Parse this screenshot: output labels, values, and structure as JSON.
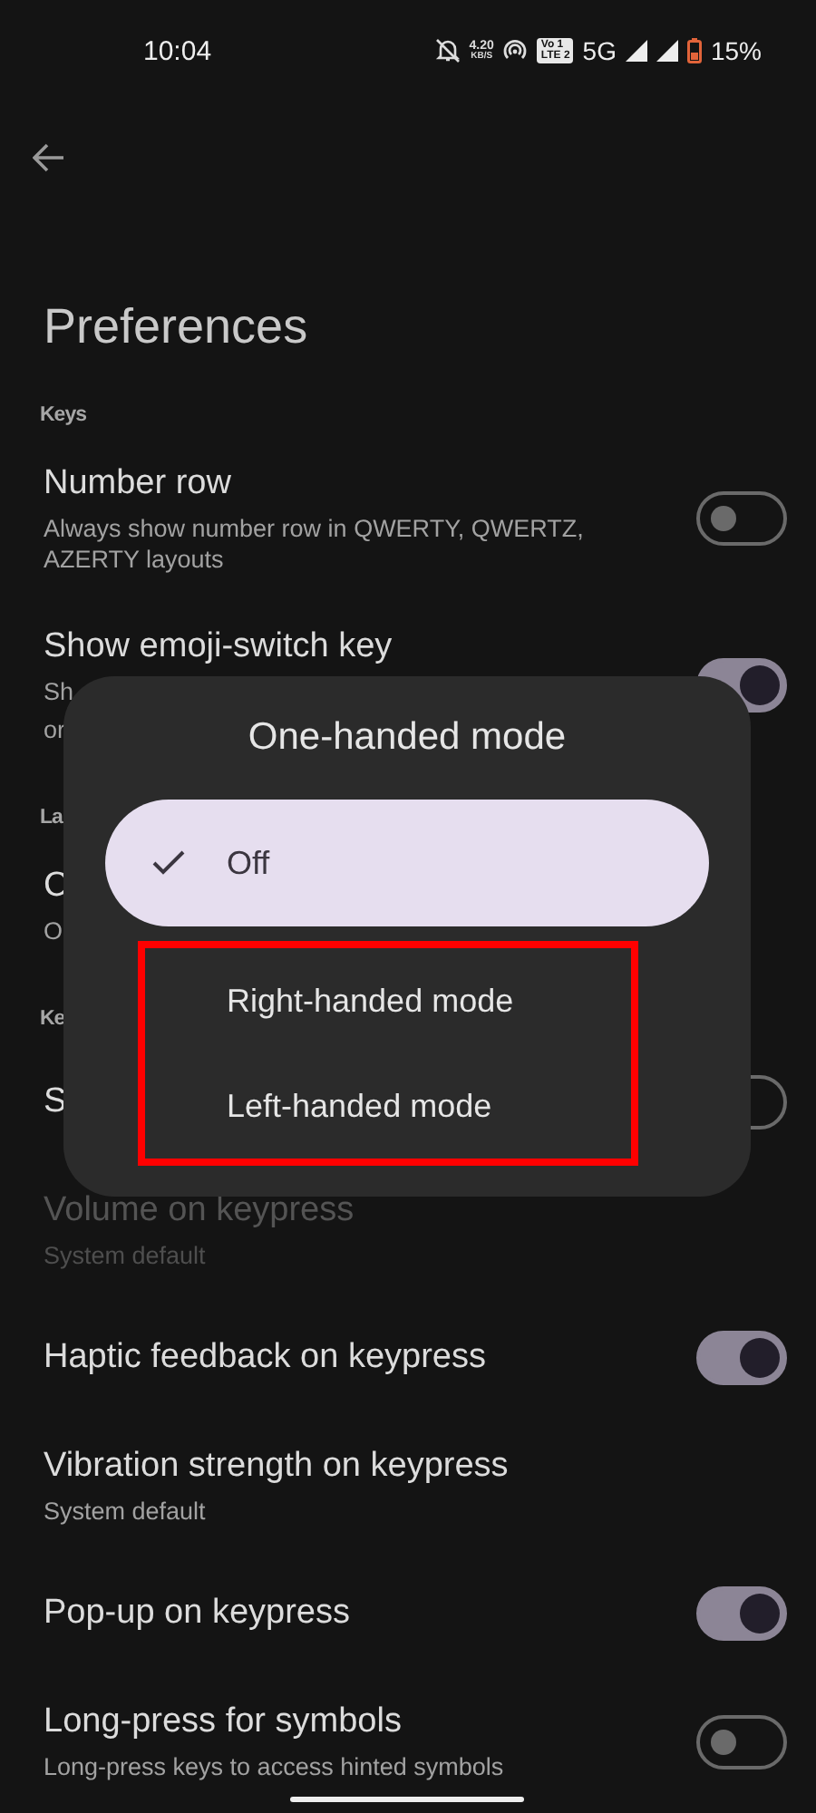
{
  "status_bar": {
    "time": "10:04",
    "speed_value": "4.20",
    "speed_unit": "KB/S",
    "volte_top": "Vo 1",
    "volte_bottom": "LTE 2",
    "network": "5G",
    "battery": "15%"
  },
  "title": "Preferences",
  "items": [
    {
      "kind": "header",
      "label": "Keys"
    },
    {
      "kind": "setting",
      "title": "Number row",
      "subtitle": "Always show number row in QWERTY, QWERTZ, AZERTY layouts",
      "on": false,
      "disabled": false
    },
    {
      "kind": "setting",
      "title": "Show emoji-switch key",
      "subtitle_lines": [
        "Sh",
        "or"
      ],
      "on": true,
      "disabled": false
    },
    {
      "kind": "header",
      "label": "La"
    },
    {
      "kind": "setting",
      "title": "C",
      "subtitle": "O",
      "disabled": false
    },
    {
      "kind": "header",
      "label": "Ke"
    },
    {
      "kind": "setting",
      "title": "S",
      "on": false,
      "disabled": false
    },
    {
      "kind": "setting",
      "title": "Volume on keypress",
      "subtitle": "System default",
      "disabled": true
    },
    {
      "kind": "setting",
      "title": "Haptic feedback on keypress",
      "on": true,
      "disabled": false
    },
    {
      "kind": "setting",
      "title": "Vibration strength on keypress",
      "subtitle": "System default",
      "disabled": false
    },
    {
      "kind": "setting",
      "title": "Pop-up on keypress",
      "on": true,
      "disabled": false
    },
    {
      "kind": "setting",
      "title": "Long-press for symbols",
      "subtitle": "Long-press keys to access hinted symbols",
      "on": false,
      "disabled": false
    }
  ],
  "dialog": {
    "title": "One-handed mode",
    "options": [
      {
        "label": "Off",
        "selected": true,
        "highlighted": false
      },
      {
        "label": "Right-handed mode",
        "selected": false,
        "highlighted": true
      },
      {
        "label": "Left-handed mode",
        "selected": false,
        "highlighted": true
      }
    ]
  }
}
